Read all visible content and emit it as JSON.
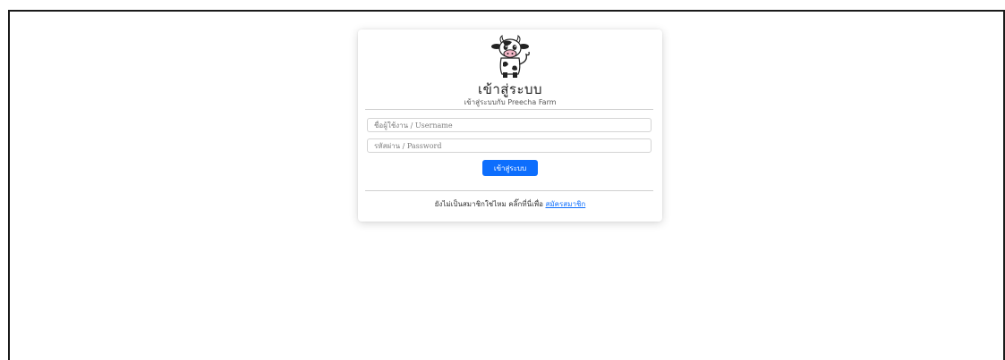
{
  "login": {
    "logo_icon": "cow-mascot-icon",
    "title": "เข้าสู่ระบบ",
    "subtitle": "เข้าสู่ระบบกับ Preecha Farm",
    "username_placeholder": "ชื่อผู้ใช้งาน / Username",
    "username_value": "",
    "password_placeholder": "รหัสผ่าน / Password",
    "password_value": "",
    "submit_label": "เข้าสู่ระบบ",
    "footer_text": "ยังไม่เป็นสมาชิกใช่ไหม คลิ๊กที่นี่เพื่อ",
    "register_link": "สมัครสมาชิก"
  },
  "colors": {
    "primary": "#0d6efd",
    "frame_border": "#1a1a1a",
    "card_bg": "#ffffff"
  }
}
